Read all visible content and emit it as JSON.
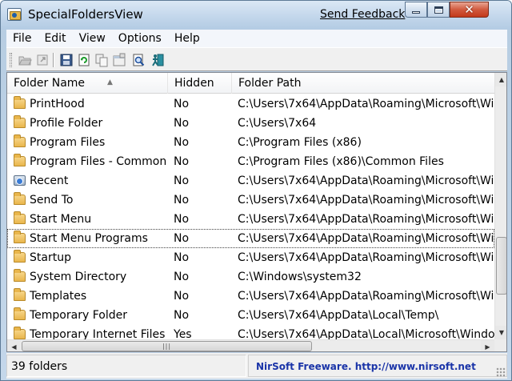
{
  "window": {
    "title": "SpecialFoldersView",
    "feedback_link": "Send Feedback",
    "close_symbol": "✕"
  },
  "menu": [
    "File",
    "Edit",
    "View",
    "Options",
    "Help"
  ],
  "toolbar": {
    "icons": [
      "open-folder-icon",
      "open-link-icon",
      "save-icon",
      "refresh-icon",
      "copy-icon",
      "properties-icon",
      "search-icon",
      "exit-icon"
    ]
  },
  "columns": [
    {
      "label": "Folder Name",
      "sort": "ascending"
    },
    {
      "label": "Hidden"
    },
    {
      "label": "Folder Path"
    }
  ],
  "rows": [
    {
      "name": "PrintHood",
      "hidden": "No",
      "path": "C:\\Users\\7x64\\AppData\\Roaming\\Microsoft\\Wi",
      "icon": "folder-icon"
    },
    {
      "name": "Profile Folder",
      "hidden": "No",
      "path": "C:\\Users\\7x64",
      "icon": "folder-icon"
    },
    {
      "name": "Program Files",
      "hidden": "No",
      "path": "C:\\Program Files (x86)",
      "icon": "folder-icon"
    },
    {
      "name": "Program Files - Common",
      "hidden": "No",
      "path": "C:\\Program Files (x86)\\Common Files",
      "icon": "folder-icon"
    },
    {
      "name": "Recent",
      "hidden": "No",
      "path": "C:\\Users\\7x64\\AppData\\Roaming\\Microsoft\\Wi",
      "icon": "recent-icon"
    },
    {
      "name": "Send To",
      "hidden": "No",
      "path": "C:\\Users\\7x64\\AppData\\Roaming\\Microsoft\\Wi",
      "icon": "folder-icon"
    },
    {
      "name": "Start Menu",
      "hidden": "No",
      "path": "C:\\Users\\7x64\\AppData\\Roaming\\Microsoft\\Wi",
      "icon": "folder-icon"
    },
    {
      "name": "Start Menu Programs",
      "hidden": "No",
      "path": "C:\\Users\\7x64\\AppData\\Roaming\\Microsoft\\Wi",
      "icon": "folder-icon",
      "focused": true
    },
    {
      "name": "Startup",
      "hidden": "No",
      "path": "C:\\Users\\7x64\\AppData\\Roaming\\Microsoft\\Wi",
      "icon": "folder-icon"
    },
    {
      "name": "System Directory",
      "hidden": "No",
      "path": "C:\\Windows\\system32",
      "icon": "folder-icon"
    },
    {
      "name": "Templates",
      "hidden": "No",
      "path": "C:\\Users\\7x64\\AppData\\Roaming\\Microsoft\\Wi",
      "icon": "folder-icon"
    },
    {
      "name": "Temporary Folder",
      "hidden": "No",
      "path": "C:\\Users\\7x64\\AppData\\Local\\Temp\\",
      "icon": "folder-icon"
    },
    {
      "name": "Temporary Internet Files",
      "hidden": "Yes",
      "path": "C:\\Users\\7x64\\AppData\\Local\\Microsoft\\Windo",
      "icon": "folder-icon"
    }
  ],
  "status": {
    "count": "39 folders",
    "credit": "NirSoft Freeware.  http://www.nirsoft.net"
  },
  "colors": {
    "credit_text": "#1a34a8",
    "close_button": "#c3391a"
  }
}
